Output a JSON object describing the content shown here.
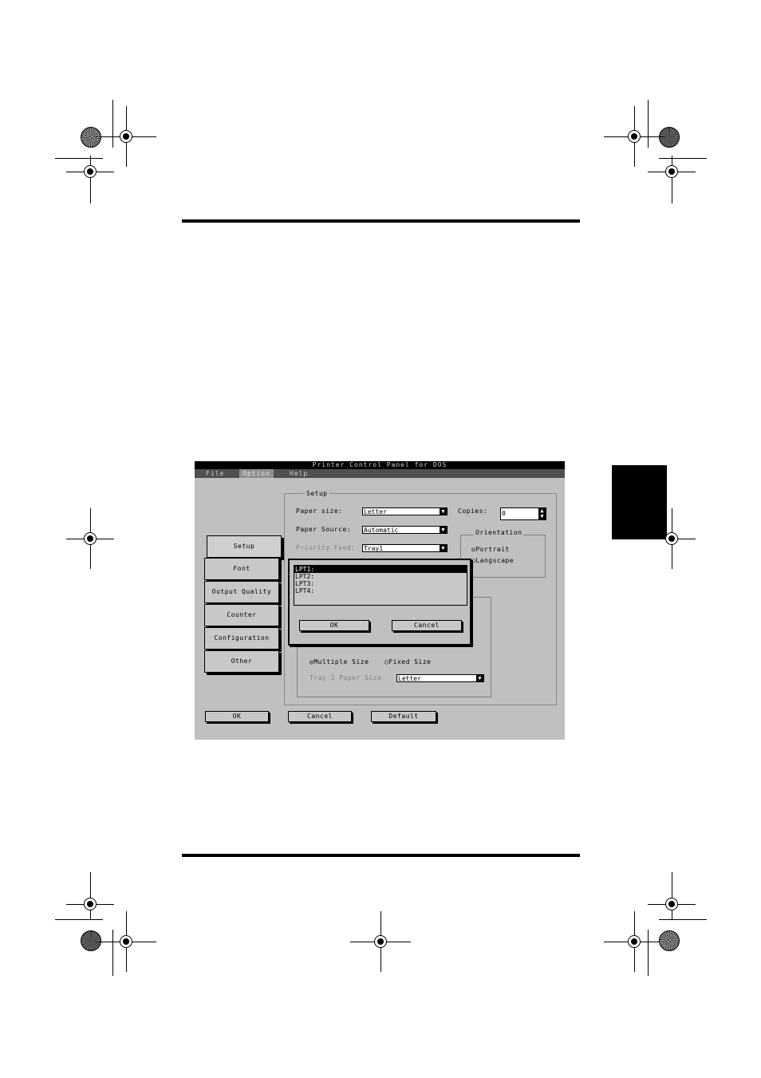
{
  "app": {
    "title": "Printer Control Panel for DOS",
    "menu": [
      {
        "label": "File",
        "selected": false
      },
      {
        "label": "Option",
        "selected": true
      },
      {
        "label": "Help",
        "selected": false
      }
    ]
  },
  "tabs": [
    "Setup",
    "Font",
    "Output Quality",
    "Counter",
    "Configuration",
    "Other"
  ],
  "active_tab": "Setup",
  "setup": {
    "group_label": "Setup",
    "paper_size_label": "Paper size:",
    "paper_size_value": "Letter",
    "paper_source_label": "Paper Source:",
    "paper_source_value": "Automatic",
    "priority_feed_label": "Priority Feed:",
    "priority_feed_value": "Tray1",
    "copies_label": "Copies:",
    "copies_value": "0",
    "orientation_label": "Orientation",
    "portrait_label": "Portrait",
    "landscape_label": "Langscape",
    "multiple_size_label": "Multiple Size",
    "fixed_size_label": "Fixed Size",
    "tray_paper_size_label": "Tray 1 Paper Size",
    "tray_paper_size_value": "Letter"
  },
  "dialog": {
    "ports": [
      "LPT1:",
      "LPT2:",
      "LPT3:",
      "LPT4:"
    ],
    "selected_index": 0,
    "ok_label": "OK",
    "cancel_label": "Cancel"
  },
  "footer": {
    "ok_label": "OK",
    "cancel_label": "Cancel",
    "default_label": "Default"
  },
  "glyphs": {
    "down_arrow": "▼",
    "up_arrow": "▲",
    "radio_on": "◎",
    "radio_off": "○"
  }
}
